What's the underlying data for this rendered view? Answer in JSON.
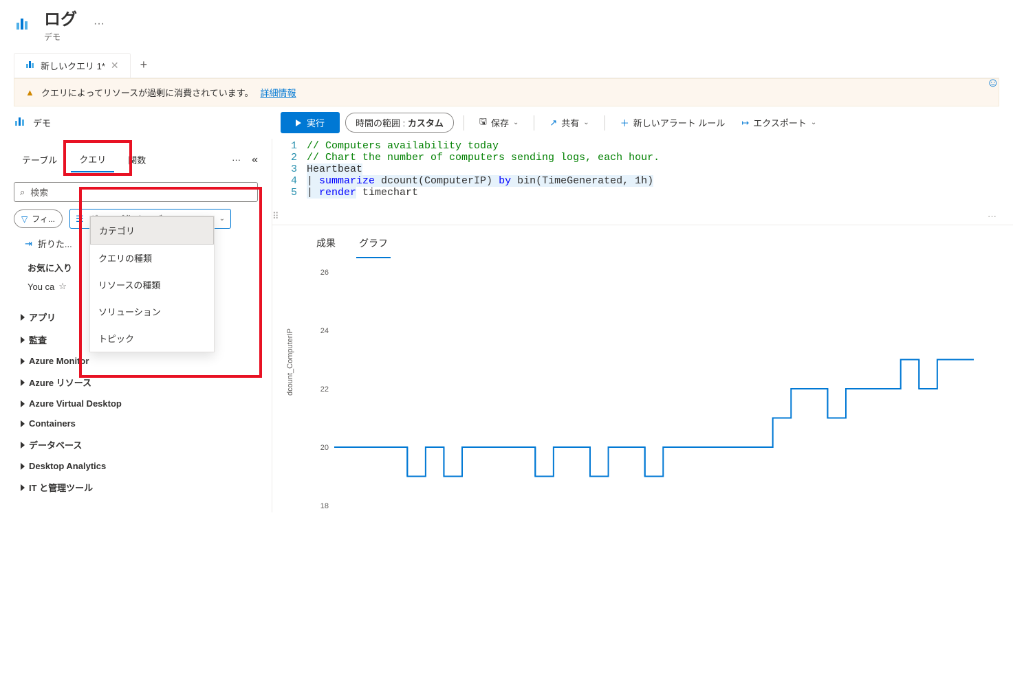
{
  "header": {
    "title": "ログ",
    "sub": "デモ"
  },
  "tabs": {
    "tab1_label": "新しいクエリ 1*"
  },
  "warning": {
    "msg": "クエリによってリソースが過剰に消費されています。",
    "link": "詳細情報"
  },
  "toolbar": {
    "scope": "デモ",
    "run": "実行",
    "time_label": "時間の範囲 :",
    "time_value": "カスタム",
    "save": "保存",
    "share": "共有",
    "alert": "新しいアラート ルール",
    "export": "エクスポート"
  },
  "side": {
    "tabs": {
      "tables": "テーブル",
      "queries": "クエリ",
      "functions": "関数"
    },
    "search_ph": "検索",
    "filter": "フィ...",
    "group_by": "グループ化:カテゴリ",
    "dropdown": {
      "opt0": "カテゴリ",
      "opt1": "クエリの種類",
      "opt2": "リソースの種類",
      "opt3": "ソリューション",
      "opt4": "トピック"
    },
    "fold": "折りた...",
    "fav": "お気に入り",
    "youcan": "You ca",
    "cats": {
      "c0": "アプリ",
      "c1": "監査",
      "c2": "Azure Monitor",
      "c3": "Azure リソース",
      "c4": "Azure Virtual Desktop",
      "c5": "Containers",
      "c6": "データベース",
      "c7": "Desktop Analytics",
      "c8": "IT と管理ツール"
    }
  },
  "editor": {
    "l1": "// Computers availability today",
    "l2": "// Chart the number of computers sending logs, each hour.",
    "l3": "Heartbeat",
    "l4_pre": "| ",
    "l4_kw": "summarize",
    "l4_mid": " dcount(ComputerIP) ",
    "l4_kw2": "by",
    "l4_end": " bin(TimeGenerated, 1h)",
    "l5_pre": "| ",
    "l5_kw": "render",
    "l5_end": " timechart"
  },
  "results": {
    "tab_results": "成果",
    "tab_chart": "グラフ"
  },
  "chart_data": {
    "type": "line",
    "ylabel": "dcount_ComputerIP",
    "ylim": [
      18,
      26
    ],
    "yticks": [
      18,
      20,
      22,
      24,
      26
    ],
    "series": [
      {
        "name": "dcount_ComputerIP",
        "values": [
          20,
          20,
          20,
          20,
          19,
          20,
          19,
          20,
          20,
          20,
          20,
          19,
          20,
          20,
          19,
          20,
          20,
          19,
          20,
          20,
          20,
          20,
          20,
          20,
          21,
          22,
          22,
          21,
          22,
          22,
          22,
          23,
          22,
          23,
          23,
          23
        ]
      }
    ]
  }
}
